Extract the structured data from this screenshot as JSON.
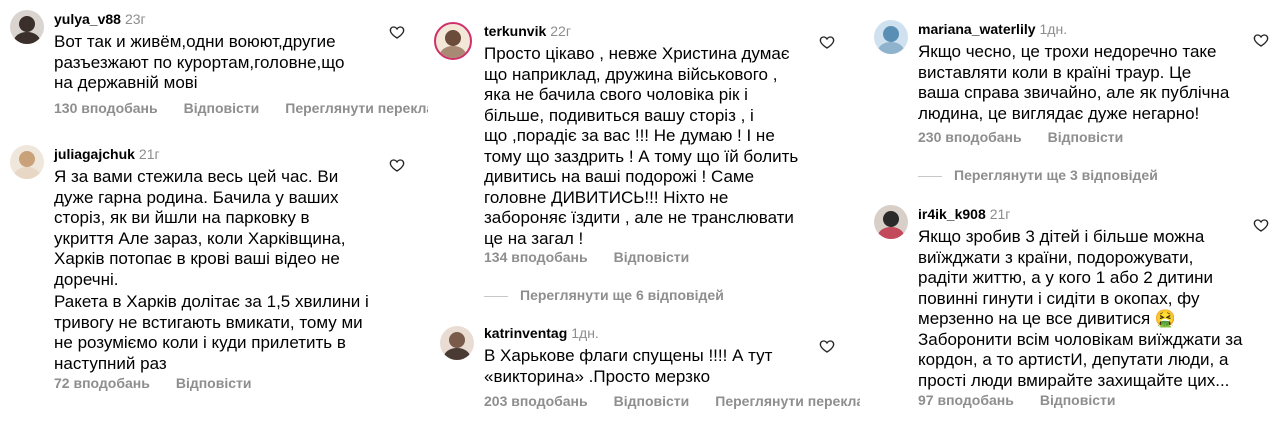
{
  "columns": [
    {
      "comments": [
        {
          "username": "yulya_v88",
          "time": "23г",
          "lines": [
            "Вот так и живём,одни воюют,другие",
            "разъезжают по курортам,головне,що",
            "на державній мові"
          ],
          "likes": "130 вподобань",
          "reply": "Відповісти",
          "translate": "Переглянути перекла"
        },
        {
          "username": "juliagajchuk",
          "time": "21г",
          "lines": [
            "Я за вами стежила весь цей час. Ви",
            "дуже гарна родина. Бачила у ваших",
            "сторіз, як ви йшли на парковку в",
            "укриття Але зараз, коли Харківщина,",
            "Харків потопає в крові ваші відео не",
            "доречні.",
            "Ракета в Харків долітає за 1,5 хвилини і",
            "тривогу не встигають вмикати, тому ми",
            "не розуміємо коли і куди прилетить в",
            "наступний раз"
          ],
          "likes": "72 вподобань",
          "reply": "Відповісти"
        }
      ]
    },
    {
      "comments": [
        {
          "username": "terkunvik",
          "time": "22г",
          "lines": [
            "Просто цікаво , невже Христина думає",
            "що наприклад, дружина військового ,",
            "яка не бачила свого чоловіка рік і",
            "більше, подивиться вашу сторіз , і",
            "що ,порадіє за вас !!! Не думаю ! І не",
            "тому що заздрить ! А тому що їй болить",
            "дивитись на ваші подорожі ! Саме",
            "головне ДИВИТИСЬ!!! Ніхто не",
            "забороняє їздити , але не транслювати",
            "це на загал !"
          ],
          "likes": "134 вподобань",
          "reply": "Відповісти"
        },
        {
          "username": "katrinventag",
          "time": "1дн.",
          "lines": [
            "В Харькове флаги спущены !!!! А тут",
            "«викторина» .Просто мерзко"
          ],
          "likes": "203 вподобань",
          "reply": "Відповісти",
          "translate": "Переглянути перекла"
        }
      ],
      "view_replies": "Переглянути ще 6 відповідей"
    },
    {
      "comments": [
        {
          "username": "mariana_waterlily",
          "time": "1дн.",
          "lines": [
            "Якщо чесно, це трохи недоречно таке",
            "виставляти коли в країні траур. Це",
            "ваша справа звичайно, але як публічна",
            "людина, це виглядає дуже негарно!"
          ],
          "likes": "230 вподобань",
          "reply": "Відповісти"
        },
        {
          "username": "ir4ik_k908",
          "time": "21г",
          "lines": [
            "Якщо зробив 3 дітей і більше можна",
            "виїжджати з країни, подорожувати,",
            "радіти життю, а у кого 1 або 2 дитини",
            "повинні гинути і сидіти в окопах, фу",
            "мерзенно на це все дивитися 🤮",
            "Заборонити всім чоловікам виїжджати за",
            "кордон, а то артистИ, депутати люди, а",
            "прості люди вмирайте захищайте цих..."
          ],
          "likes": "97 вподобань",
          "reply": "Відповісти"
        }
      ],
      "view_replies": "Переглянути ще 3 відповідей"
    }
  ],
  "avatar_colors": [
    "#3a2f2a",
    "#c9a27a",
    "#6b4b3a",
    "#7a5a4a",
    "#5a8fb5",
    "#2a2a2a"
  ]
}
